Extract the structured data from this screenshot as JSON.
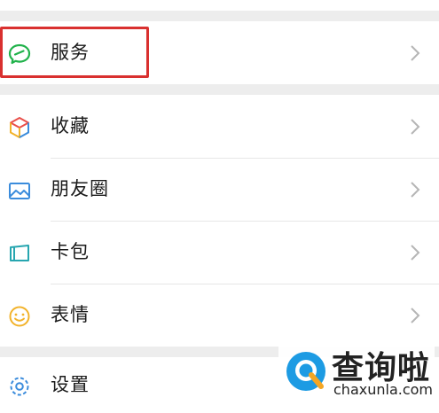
{
  "menu": {
    "items": [
      {
        "label": "服务",
        "icon": "service-icon"
      },
      {
        "label": "收藏",
        "icon": "favorites-icon"
      },
      {
        "label": "朋友圈",
        "icon": "moments-icon"
      },
      {
        "label": "卡包",
        "icon": "card-wallet-icon"
      },
      {
        "label": "表情",
        "icon": "sticker-icon"
      },
      {
        "label": "设置",
        "icon": "settings-icon"
      }
    ]
  },
  "watermark": {
    "brand": "查询啦",
    "domain": "chaxunla.com"
  },
  "colors": {
    "highlight": "#d9302f",
    "service_icon": "#21b24b",
    "background": "#ededed"
  }
}
